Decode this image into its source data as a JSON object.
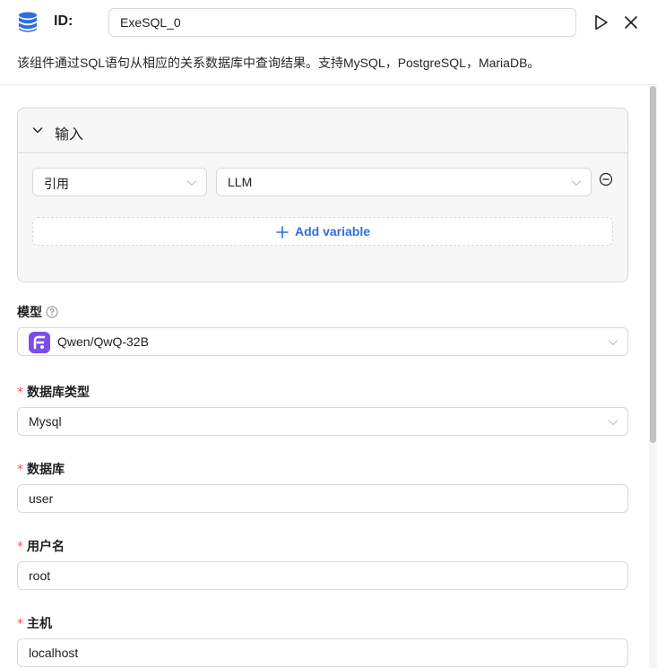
{
  "header": {
    "id_label": "ID:",
    "id_value": "ExeSQL_0",
    "description": "该组件通过SQL语句从相应的关系数据库中查询结果。支持MySQL，PostgreSQL，MariaDB。"
  },
  "input_panel": {
    "title": "输入",
    "rows": [
      {
        "source": "引用",
        "value": "LLM"
      }
    ],
    "add_variable_label": "Add variable"
  },
  "fields": {
    "model": {
      "label": "模型",
      "value": "Qwen/QwQ-32B"
    },
    "db_type": {
      "required_mark": "*",
      "label": "数据库类型",
      "value": "Mysql"
    },
    "database": {
      "required_mark": "*",
      "label": "数据库",
      "value": "user"
    },
    "username": {
      "required_mark": "*",
      "label": "用户名",
      "value": "root"
    },
    "host": {
      "required_mark": "*",
      "label": "主机",
      "value": "localhost"
    }
  },
  "colors": {
    "accent": "#2f6ee0",
    "required": "#ff4d4f",
    "db_icon": "#2f6ee0",
    "model_logo": "#7c4dea"
  },
  "icons": {
    "db": "database-icon",
    "run": "play-icon",
    "close": "close-icon",
    "collapse": "chevron-down-icon",
    "select_arrow": "chevron-down-icon",
    "remove": "minus-circle-icon",
    "add": "plus-icon",
    "help": "question-circle-icon"
  }
}
